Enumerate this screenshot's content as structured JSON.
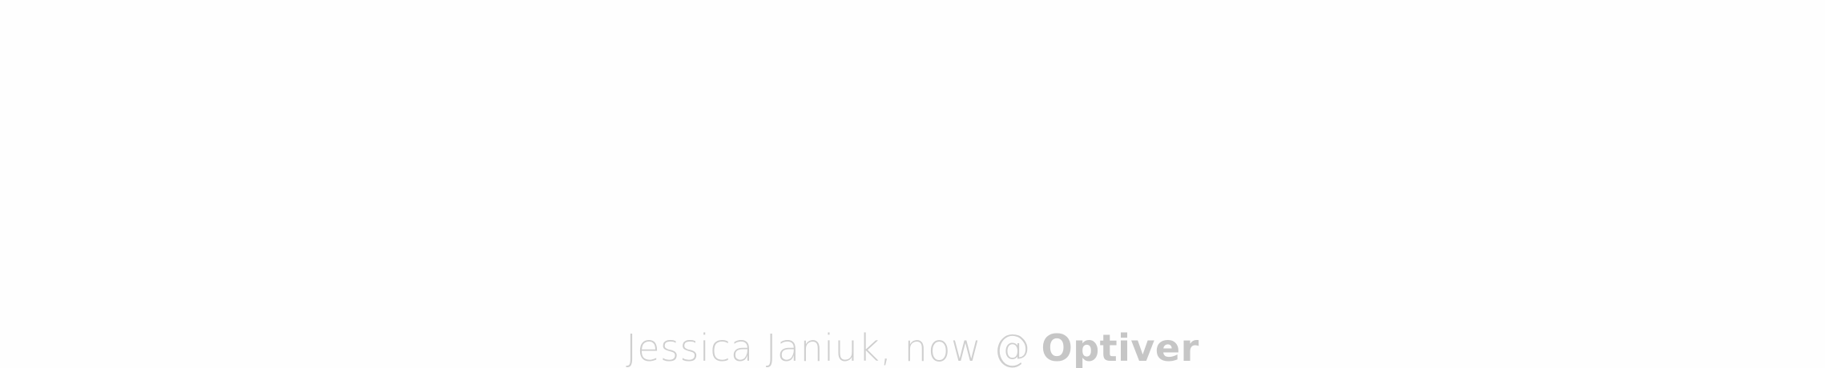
{
  "footer": {
    "credit_text": "Jessica Janiuk, now @",
    "company": "Optiver"
  },
  "colors": {
    "background": "#fefefe",
    "credit_text": "#cfcfcf",
    "company_text": "#c6c6c6"
  }
}
